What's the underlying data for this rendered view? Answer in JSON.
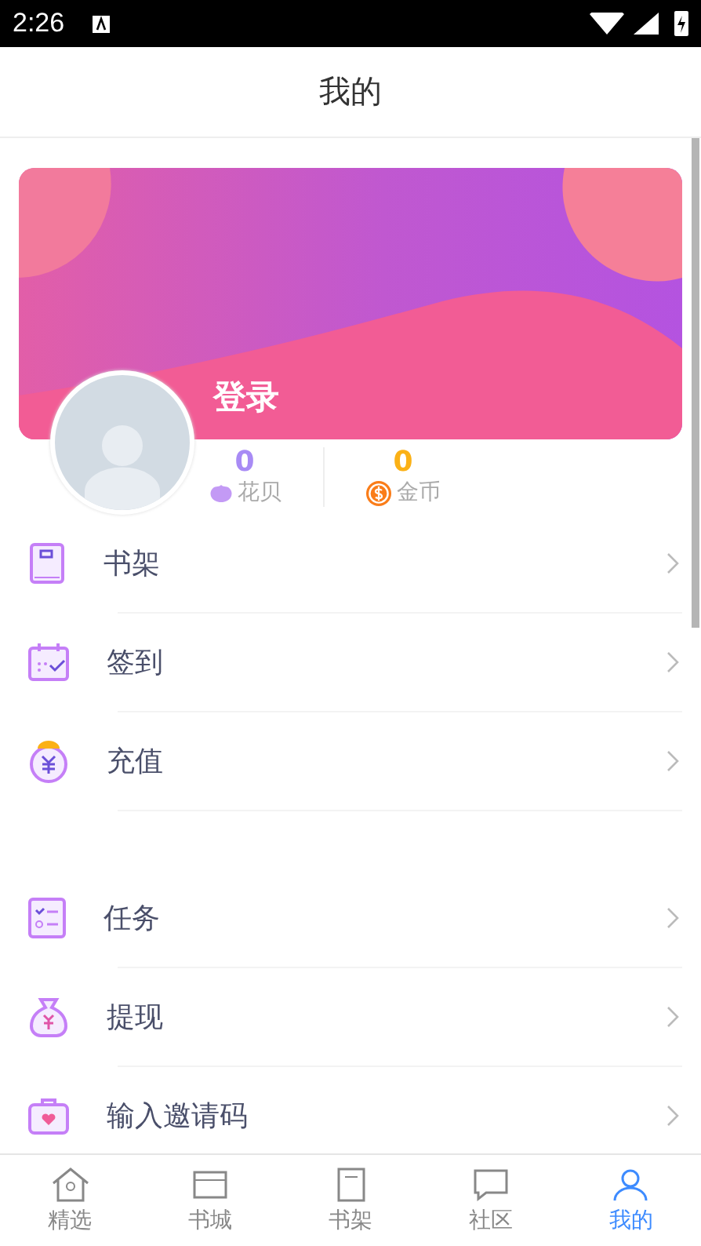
{
  "status_bar": {
    "time": "2:26"
  },
  "header": {
    "title": "我的"
  },
  "profile": {
    "login": "登录",
    "stats": [
      {
        "kind": "shells",
        "value": "0",
        "label": "花贝",
        "color": "#a88bf5"
      },
      {
        "kind": "coins",
        "value": "0",
        "label": "金币",
        "color": "#fbb116"
      }
    ]
  },
  "menu_sections": [
    [
      {
        "label": "书架"
      },
      {
        "label": "签到"
      },
      {
        "label": "充值"
      }
    ],
    [
      {
        "label": "任务"
      },
      {
        "label": "提现"
      },
      {
        "label": "输入邀请码"
      }
    ]
  ],
  "bottom_nav": [
    {
      "label": "精选",
      "selected": false
    },
    {
      "label": "书城",
      "selected": false
    },
    {
      "label": "书架",
      "selected": false
    },
    {
      "label": "社区",
      "selected": false
    },
    {
      "label": "我的",
      "selected": true
    }
  ]
}
